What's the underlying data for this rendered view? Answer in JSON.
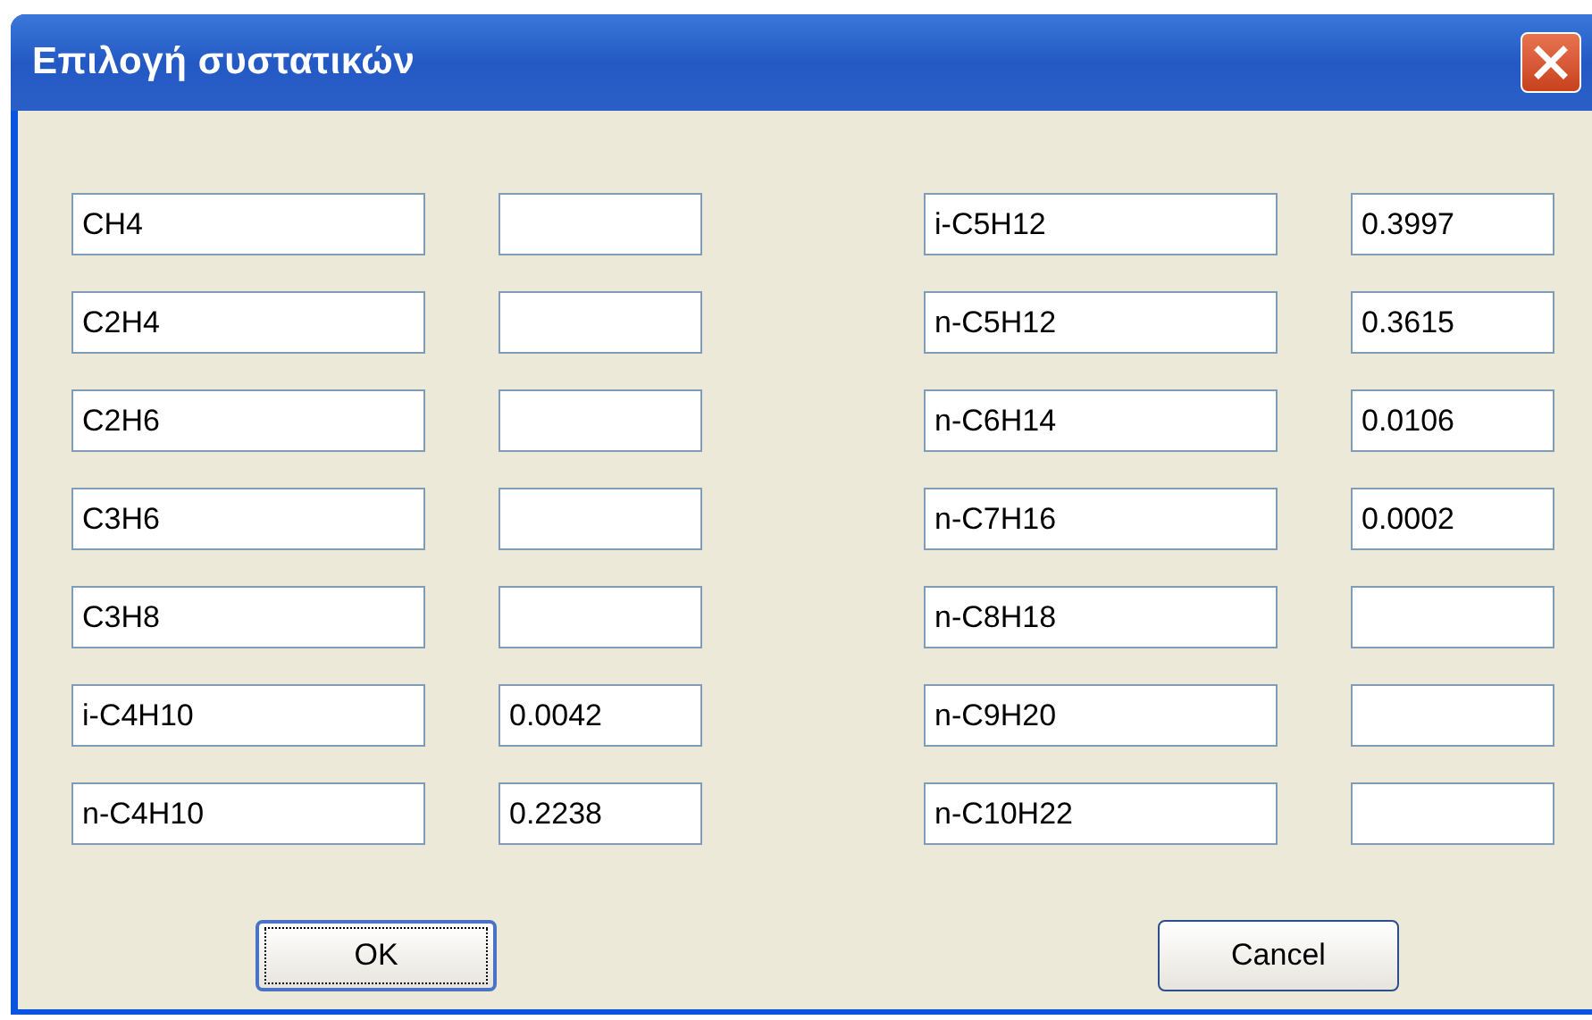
{
  "window": {
    "title": "Επιλογή συστατικών"
  },
  "left_rows": [
    {
      "name": "CH4"
    },
    {
      "name": "C2H4"
    },
    {
      "name": "C2H6"
    },
    {
      "name": "C3H6"
    },
    {
      "name": "C3H8"
    },
    {
      "name": "i-C4H10",
      "value": "0.0042"
    },
    {
      "name": "n-C4H10",
      "value": "0.2238"
    }
  ],
  "right_rows": [
    {
      "name": "i-C5H12",
      "value": "0.3997"
    },
    {
      "name": "n-C5H12",
      "value": "0.3615"
    },
    {
      "name": "n-C6H14",
      "value": "0.0106"
    },
    {
      "name": "n-C7H16",
      "value": "0.0002"
    },
    {
      "name": "n-C8H18"
    },
    {
      "name": "n-C9H20"
    },
    {
      "name": "n-C10H22"
    }
  ],
  "buttons": [
    {
      "label": "OK",
      "focused": true
    },
    {
      "label": "Cancel",
      "focused": false
    }
  ]
}
